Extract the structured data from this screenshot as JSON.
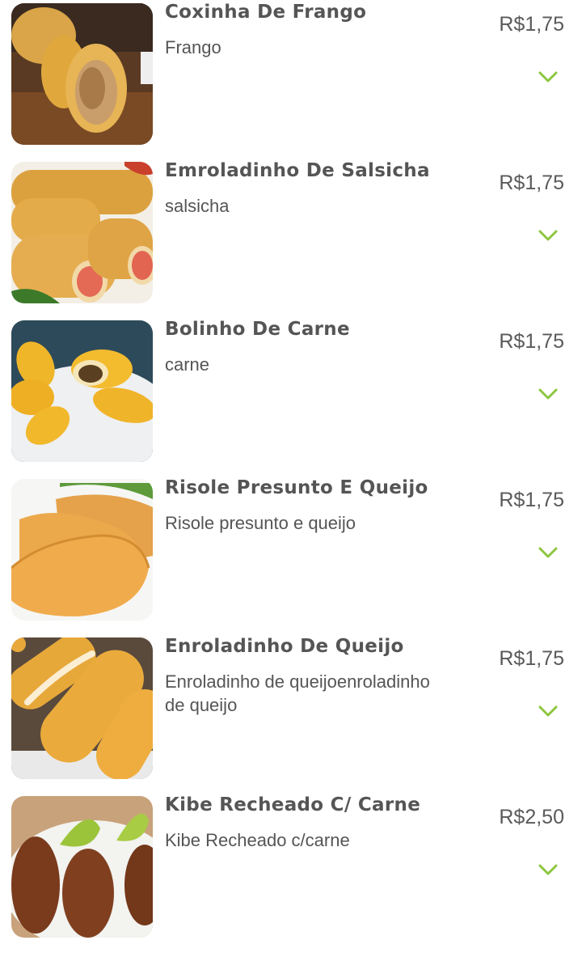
{
  "products": [
    {
      "name": "Coxinha De Frango",
      "description": " Frango",
      "price": "R$1,75",
      "image": "coxinha-photo"
    },
    {
      "name": "Emroladinho De Salsicha",
      "description": " salsicha",
      "price": "R$1,75",
      "image": "sausage-roll-photo"
    },
    {
      "name": "Bolinho De Carne",
      "description": " carne",
      "price": "R$1,75",
      "image": "meat-ball-photo"
    },
    {
      "name": "Risole Presunto E Queijo",
      "description": "Risole presunto e queijo",
      "price": "R$1,75",
      "image": "risole-photo"
    },
    {
      "name": "Enroladinho De Queijo",
      "description": "Enroladinho de queijoenroladinho de queijo",
      "price": "R$1,75",
      "image": "cheese-roll-photo"
    },
    {
      "name": "Kibe Recheado C/ Carne",
      "description": "Kibe Recheado c/carne",
      "price": "R$2,50",
      "image": "kibe-photo"
    }
  ],
  "colors": {
    "accent": "#8cc63f",
    "text": "#555555"
  },
  "icons": {
    "expand": "chevron-down-icon"
  }
}
